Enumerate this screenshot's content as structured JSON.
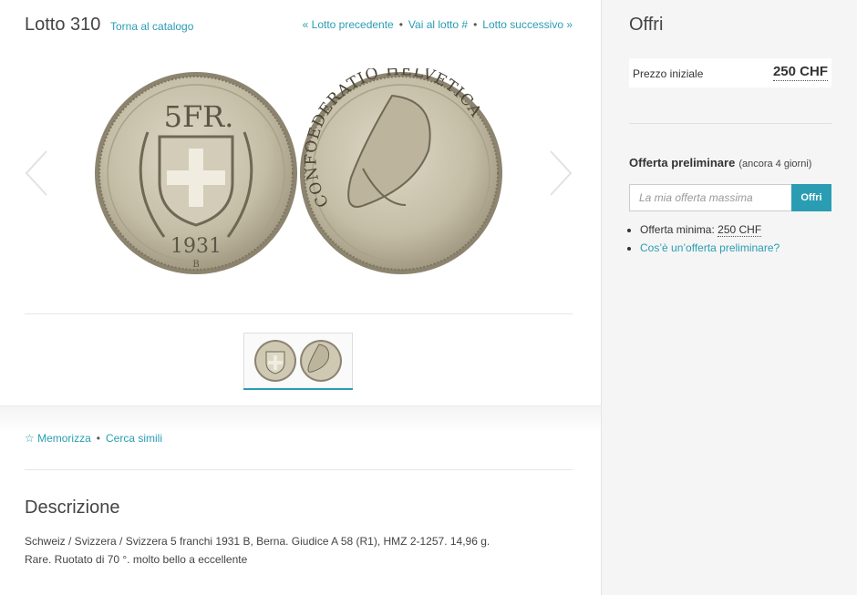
{
  "lot": {
    "title": "Lotto 310",
    "back_link": "Torna al catalogo",
    "nav": {
      "previous": "« Lotto precedente",
      "goto": "Vai al lotto #",
      "next": "Lotto successivo »"
    }
  },
  "coin": {
    "obverse_denomination": "5FR.",
    "obverse_year": "1931",
    "obverse_mint": "B",
    "reverse_legend": "CONFOEDERATIO HELVETICA"
  },
  "actions": {
    "memorize": "☆ Memorizza",
    "search_similar": "Cerca simili"
  },
  "description": {
    "title": "Descrizione",
    "line1": "Schweiz / Svizzera / Svizzera 5 franchi 1931 B, Berna. Giudice A 58 (R1), HMZ 2-1257. 14,96 g.",
    "line2": "Rare. Ruotato di 70 °. molto bello a eccellente"
  },
  "offer": {
    "title": "Offri",
    "start_price_label": "Prezzo iniziale",
    "start_price_value": "250 CHF",
    "preliminary_title": "Offerta preliminare",
    "preliminary_remaining": "(ancora 4 giorni)",
    "input_placeholder": "La mia offerta massima",
    "submit_label": "Offri",
    "min_bid_label": "Offerta minima:",
    "min_bid_value": "250 CHF",
    "what_is_link": "Cos’è un’offerta preliminare?"
  },
  "colors": {
    "accent": "#2a9db3",
    "sidebar_bg": "#f5f5f5",
    "coin_silver": "#c9c2ac"
  },
  "icons": [
    "chevron-left-icon",
    "chevron-right-icon",
    "star-icon"
  ]
}
